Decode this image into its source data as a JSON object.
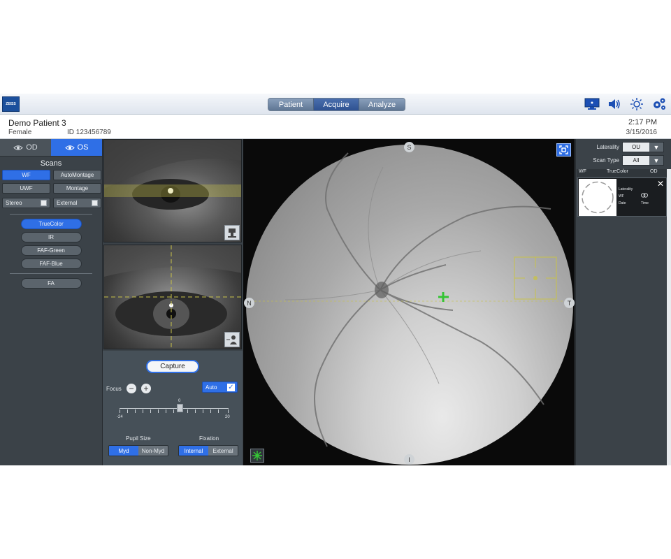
{
  "app": {
    "logo_text": "ZEISS",
    "nav_tabs": [
      "Patient",
      "Acquire",
      "Analyze"
    ],
    "active_tab": "Acquire"
  },
  "patient": {
    "name": "Demo Patient 3",
    "sex": "Female",
    "id": "ID 123456789",
    "time": "2:17 PM",
    "date": "3/15/2016"
  },
  "left": {
    "eye_tabs": [
      "OD",
      "OS"
    ],
    "active_eye": "OS",
    "scans_title": "Scans",
    "scan_buttons": [
      "WF",
      "AutoMontage",
      "UWF",
      "Montage"
    ],
    "active_scan": "WF",
    "toggles": [
      "Stereo",
      "External"
    ],
    "modes": [
      "TrueColor",
      "IR",
      "FAF-Green",
      "FAF-Blue"
    ],
    "active_mode": "TrueColor",
    "extra_mode": "FA"
  },
  "controls": {
    "capture": "Capture",
    "focus": "Focus",
    "auto": "Auto",
    "slider_min": "-24",
    "slider_max": "20",
    "slider_value": "0",
    "pupil_label": "Pupil Size",
    "pupil_options": [
      "Myd",
      "Non-Myd"
    ],
    "pupil_selected": "Myd",
    "fixation_label": "Fixation",
    "fixation_options": [
      "Internal",
      "External"
    ],
    "fixation_selected": "Internal"
  },
  "main": {
    "directions": {
      "top": "S",
      "bottom": "I",
      "left": "N",
      "right": "T"
    }
  },
  "right": {
    "laterality_label": "Laterality",
    "laterality_value": "OU",
    "scantype_label": "Scan Type",
    "scantype_value": "All",
    "thumb_header": [
      "WF",
      "TrueColor",
      "OD"
    ],
    "thumb_info": {
      "laterality": "Laterality",
      "scan": "WF",
      "date": "Date",
      "time": "Time"
    }
  },
  "colors": {
    "accent": "#2f6fe6",
    "panel": "#3b4248",
    "fixation_cross": "#35c435",
    "guide_line": "#c8c24a"
  },
  "icons": [
    "monitor-icon",
    "speaker-icon",
    "brightness-icon",
    "settings-icon",
    "expand-icon",
    "fixation-target-icon",
    "camera-icon",
    "eye-icon"
  ]
}
